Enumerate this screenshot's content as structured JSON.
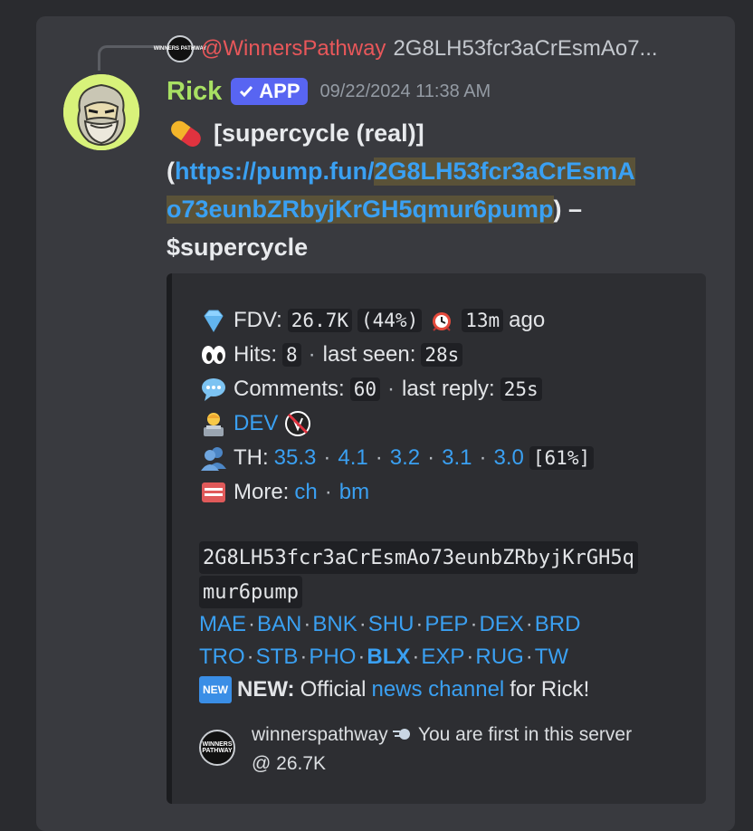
{
  "reply": {
    "logo_text": "WINNERS PATHWAY",
    "username": "@WinnersPathway",
    "preview": "2G8LH53fcr3aCrEsmAo7..."
  },
  "author": {
    "name": "Rick",
    "badge": "APP",
    "timestamp": "09/22/2024 11:38 AM"
  },
  "message": {
    "title": "[supercycle (real)]",
    "paren_open": "(",
    "link_prefix": "https://pump.fun/",
    "link_hl_1": "2G8LH53fcr3aCrEsmA",
    "link_hl_2": "o73eunbZRbyjKrGH5qmur6pump",
    "paren_close": ") –",
    "ticker": "$supercycle"
  },
  "embed": {
    "fdv_label": "FDV:",
    "fdv_value": "26.7K",
    "fdv_pct": "(44%)",
    "age": "13m",
    "age_suffix": "ago",
    "hits_label": "Hits:",
    "hits_value": "8",
    "last_seen_label": "last seen:",
    "last_seen_value": "28s",
    "comments_label": "Comments:",
    "comments_value": "60",
    "last_reply_label": "last reply:",
    "last_reply_value": "25s",
    "dev_label": "DEV",
    "th_label": "TH:",
    "th_values": [
      "35.3",
      "4.1",
      "3.2",
      "3.1",
      "3.0"
    ],
    "th_total": "[61%]",
    "more_label": "More:",
    "more_links": [
      "ch",
      "bm"
    ],
    "contract_1": "2G8LH53fcr3aCrEsmAo73eunbZRbyjKrGH5q",
    "contract_2": "mur6pump",
    "links_row1": [
      "MAE",
      "BAN",
      "BNK",
      "SHU",
      "PEP",
      "DEX",
      "BRD"
    ],
    "links_row2": [
      "TRO",
      "STB",
      "PHO",
      "BLX",
      "EXP",
      "RUG",
      "TW"
    ],
    "new_badge": "NEW",
    "new_label": "NEW:",
    "new_text_1": "Official",
    "new_link": "news channel",
    "new_text_2": "for Rick!",
    "footer_logo_text": "WINNERS PATHWAY",
    "footer_user": "winnerspathway",
    "footer_text_1": "You are first in this server",
    "footer_text_2": "@ 26.7K"
  },
  "colors": {
    "reply_user": "#e8575a",
    "username": "#a8e063",
    "badge": "#5865f2",
    "link": "#3aa0f2",
    "highlight": "#5a5238"
  }
}
